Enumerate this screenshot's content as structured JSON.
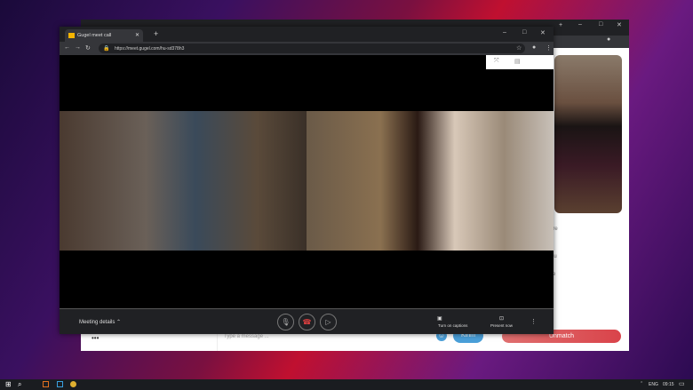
{
  "front_window": {
    "tab_title": "Gugel meet call",
    "new_tab": "+",
    "url": "https://meet.gugel.com/hu-sd378h3",
    "bottom_bar": {
      "meeting_details": "Meeting details",
      "captions": "Turn on captions",
      "present": "Present now"
    }
  },
  "back_window": {
    "fragments": [
      "are",
      "nu",
      "e"
    ],
    "message_placeholder": "Type a message ...",
    "more": "•••",
    "send_label": "Kirim",
    "unmatch_label": "Unmatch"
  },
  "taskbar": {
    "language": "ENG",
    "time": "09:15"
  },
  "colors": {
    "unmatch": "#d9434a",
    "send": "#4a9fd8"
  }
}
